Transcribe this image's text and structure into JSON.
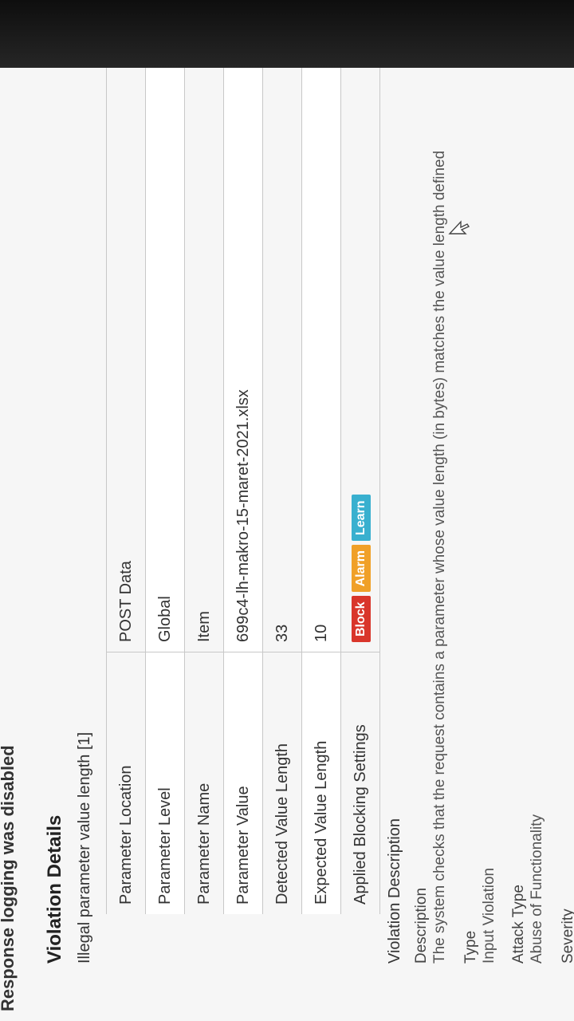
{
  "response_logging": "Response logging was disabled",
  "violation_details": {
    "title": "Violation Details",
    "name": "Illegal parameter value length [1]",
    "rows": [
      {
        "label": "Parameter Location",
        "value": "POST Data"
      },
      {
        "label": "Parameter Level",
        "value": "Global"
      },
      {
        "label": "Parameter Name",
        "value": "Item"
      },
      {
        "label": "Parameter Value",
        "value": "699c4-lh-makro-15-maret-2021.xlsx"
      },
      {
        "label": "Detected Value Length",
        "value": "33"
      },
      {
        "label": "Expected Value Length",
        "value": "10"
      },
      {
        "label": "Applied Blocking Settings",
        "value": ""
      }
    ],
    "blocking_settings": [
      {
        "label": "Block",
        "color": "#d9362b"
      },
      {
        "label": "Alarm",
        "color": "#f0a028"
      },
      {
        "label": "Learn",
        "color": "#39b0cf"
      }
    ]
  },
  "violation_description": {
    "heading": "Violation Description",
    "description_label": "Description",
    "description_text": "The system checks that the request contains a parameter whose value length (in bytes) matches the value length defined",
    "type_label": "Type",
    "type_value": "Input Violation",
    "attack_type_label": "Attack Type",
    "attack_type_value": "Abuse of Functionality",
    "severity_label": "Severity"
  }
}
